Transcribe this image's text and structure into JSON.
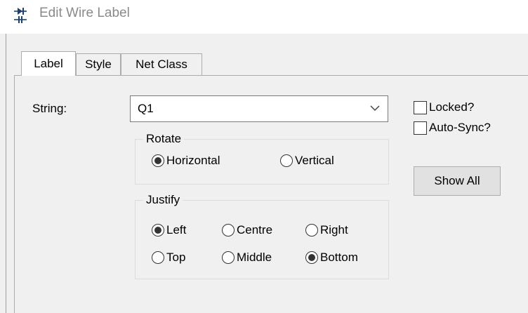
{
  "window": {
    "title": "Edit Wire Label",
    "icon": "wire-label-icon"
  },
  "tabs": [
    {
      "label": "Label",
      "active": true
    },
    {
      "label": "Style",
      "active": false
    },
    {
      "label": "Net Class",
      "active": false
    }
  ],
  "string_field": {
    "label": "String:",
    "value": "Q1"
  },
  "rotate": {
    "title": "Rotate",
    "options": [
      {
        "label": "Horizontal",
        "selected": true
      },
      {
        "label": "Vertical",
        "selected": false
      }
    ]
  },
  "justify": {
    "title": "Justify",
    "options": [
      {
        "label": "Left",
        "selected": true
      },
      {
        "label": "Centre",
        "selected": false
      },
      {
        "label": "Right",
        "selected": false
      },
      {
        "label": "Top",
        "selected": false
      },
      {
        "label": "Middle",
        "selected": false
      },
      {
        "label": "Bottom",
        "selected": true
      }
    ]
  },
  "checkboxes": [
    {
      "label": "Locked?",
      "checked": false
    },
    {
      "label": "Auto-Sync?",
      "checked": false
    }
  ],
  "show_all_button": {
    "label": "Show All"
  }
}
